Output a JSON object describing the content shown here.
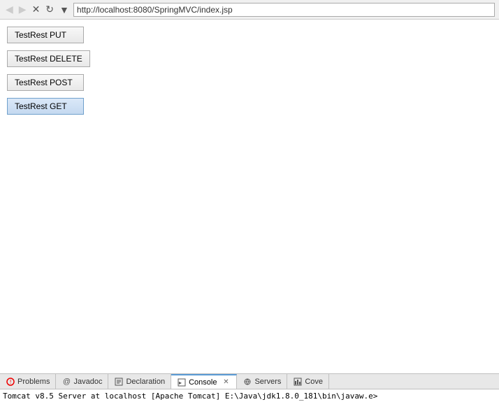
{
  "browser": {
    "back_label": "◀",
    "forward_label": "▶",
    "stop_label": "✕",
    "refresh_label": "↻",
    "menu_label": "▼",
    "url": "http://localhost:8080/SpringMVC/index.jsp"
  },
  "buttons": [
    {
      "id": "put",
      "label": "TestRest PUT",
      "active": false
    },
    {
      "id": "delete",
      "label": "TestRest DELETE",
      "active": false
    },
    {
      "id": "post",
      "label": "TestRest POST",
      "active": false
    },
    {
      "id": "get",
      "label": "TestRest GET",
      "active": true
    }
  ],
  "bottom_panel": {
    "tabs": [
      {
        "id": "problems",
        "label": "Problems",
        "icon": "⚠",
        "active": false,
        "closeable": false
      },
      {
        "id": "javadoc",
        "label": "Javadoc",
        "icon": "@",
        "active": false,
        "closeable": false
      },
      {
        "id": "declaration",
        "label": "Declaration",
        "icon": "📄",
        "active": false,
        "closeable": false
      },
      {
        "id": "console",
        "label": "Console",
        "icon": "▣",
        "active": true,
        "closeable": true
      },
      {
        "id": "servers",
        "label": "Servers",
        "icon": "⚙",
        "active": false,
        "closeable": false
      },
      {
        "id": "coverage",
        "label": "Cove",
        "icon": "📊",
        "active": false,
        "closeable": false
      }
    ],
    "console_text": "Tomcat v8.5 Server at localhost [Apache Tomcat] E:\\Java\\jdk1.8.0_181\\bin\\javaw.e>"
  }
}
